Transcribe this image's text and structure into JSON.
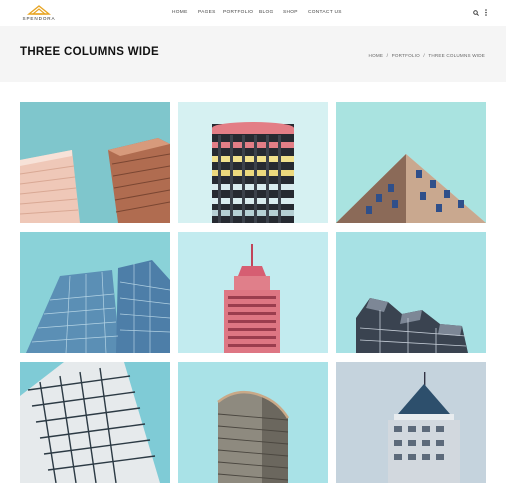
{
  "brand": {
    "name": "SPENDORA"
  },
  "nav": {
    "items": [
      {
        "label": "HOME"
      },
      {
        "label": "PAGES"
      },
      {
        "label": "PORTFOLIO"
      },
      {
        "label": "BLOG"
      },
      {
        "label": "SHOP"
      },
      {
        "label": "CONTACT US"
      }
    ]
  },
  "tools": {
    "search_icon": "search-icon",
    "menu_icon": "more-vertical-icon"
  },
  "page": {
    "title": "THREE COLUMNS WIDE"
  },
  "breadcrumb": {
    "items": [
      {
        "label": "HOME"
      },
      {
        "label": "PORTFOLIO"
      },
      {
        "label": "THREE COLUMNS WIDE"
      }
    ],
    "separator": "/"
  },
  "colors": {
    "accent": "#e8a524",
    "sky_teal": "#8fd0d4",
    "band": "#f5f5f5"
  },
  "portfolio": {
    "items": [
      {
        "image": "twin-skyscrapers-from-below"
      },
      {
        "image": "round-tower-colored-balconies"
      },
      {
        "image": "brick-building-corner"
      },
      {
        "image": "glass-skyscrapers-from-below"
      },
      {
        "image": "pink-spire-tower"
      },
      {
        "image": "cube-building-top"
      },
      {
        "image": "grid-building-diagonal"
      },
      {
        "image": "curved-tower"
      },
      {
        "image": "pointed-roof-tower"
      }
    ]
  }
}
